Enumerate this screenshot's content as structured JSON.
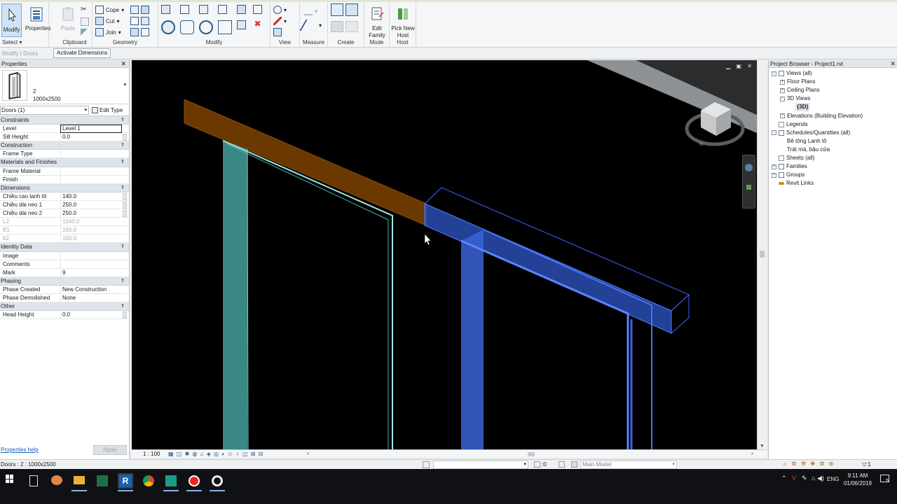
{
  "ribbon": {
    "modify": "Modify",
    "select": "Select",
    "properties": "Properties",
    "paste": "Paste",
    "cope": "Cope",
    "cut": "Cut",
    "join": "Join",
    "edit_family": "Edit Family",
    "pick_new_host": "Pick New Host",
    "groups": [
      "Clipboard",
      "Geometry",
      "Modify",
      "View",
      "Measure",
      "Create",
      "Mode",
      "Host"
    ]
  },
  "options_bar": {
    "context": "Modify | Doors",
    "activate_dimensions": "Activate Dimensions"
  },
  "properties": {
    "title": "Properties",
    "type_name": "2",
    "type_size": "1000x2500",
    "filter": "Doors (1)",
    "edit_type": "Edit Type",
    "categories": [
      {
        "name": "Constraints",
        "rows": [
          {
            "k": "Level",
            "v": "Level 1",
            "boxed": true
          },
          {
            "k": "Sill Height",
            "v": "0.0",
            "sb": true
          }
        ]
      },
      {
        "name": "Construction",
        "rows": [
          {
            "k": "Frame Type",
            "v": ""
          }
        ]
      },
      {
        "name": "Materials and Finishes",
        "rows": [
          {
            "k": "Frame Material",
            "v": ""
          },
          {
            "k": "Finish",
            "v": ""
          }
        ]
      },
      {
        "name": "Dimensions",
        "rows": [
          {
            "k": "Chiều cao lanh tô",
            "v": "140.0",
            "sb": true
          },
          {
            "k": "Chiều dài neo 1",
            "v": "250.0",
            "sb": true
          },
          {
            "k": "Chiều dài neo 2",
            "v": "250.0",
            "sb": true
          },
          {
            "k": "L2",
            "v": "1540.0",
            "dim": true
          },
          {
            "k": "B1",
            "v": "150.0",
            "dim": true
          },
          {
            "k": "b2",
            "v": "150.0",
            "dim": true
          }
        ]
      },
      {
        "name": "Identity Data",
        "rows": [
          {
            "k": "Image",
            "v": ""
          },
          {
            "k": "Comments",
            "v": ""
          },
          {
            "k": "Mark",
            "v": "9"
          }
        ]
      },
      {
        "name": "Phasing",
        "rows": [
          {
            "k": "Phase Created",
            "v": "New Construction"
          },
          {
            "k": "Phase Demolished",
            "v": "None"
          }
        ]
      },
      {
        "name": "Other",
        "rows": [
          {
            "k": "Head Height",
            "v": "0.0",
            "sb": true
          }
        ]
      }
    ],
    "help": "Properties help",
    "apply": "Apply"
  },
  "view": {
    "scale": "1 : 100"
  },
  "browser": {
    "title": "Project Browser - Project1.rvt",
    "items": [
      {
        "label": "Views (all)",
        "level": 0,
        "pm": "−",
        "icon": "views"
      },
      {
        "label": "Floor Plans",
        "level": 1,
        "pm": "+"
      },
      {
        "label": "Ceiling Plans",
        "level": 1,
        "pm": "+"
      },
      {
        "label": "3D Views",
        "level": 1,
        "pm": "−"
      },
      {
        "label": "{3D}",
        "level": 2,
        "pm": "",
        "selected": true
      },
      {
        "label": "Elevations (Building Elevation)",
        "level": 1,
        "pm": "+"
      },
      {
        "label": "Legends",
        "level": 0,
        "pm": "",
        "icon": "doc"
      },
      {
        "label": "Schedules/Quantities (all)",
        "level": 0,
        "pm": "−",
        "icon": "sched"
      },
      {
        "label": "Bê tông Lanh tô",
        "level": 1,
        "pm": ""
      },
      {
        "label": "Trát má, bậu cửa",
        "level": 1,
        "pm": ""
      },
      {
        "label": "Sheets (all)",
        "level": 0,
        "pm": "",
        "icon": "doc"
      },
      {
        "label": "Families",
        "level": 0,
        "pm": "+",
        "icon": "fam"
      },
      {
        "label": "Groups",
        "level": 0,
        "pm": "+",
        "icon": "grp"
      },
      {
        "label": "Revit Links",
        "level": 0,
        "pm": "",
        "icon": "link"
      }
    ]
  },
  "status": {
    "text": "Doors : 2 : 1000x2500",
    "zero": ":0",
    "model": "Main Model",
    "filter_count": ":1"
  },
  "taskbar": {
    "lang": "ENG",
    "time": "9:11 AM",
    "date": "01/06/2019",
    "notif": "5"
  }
}
